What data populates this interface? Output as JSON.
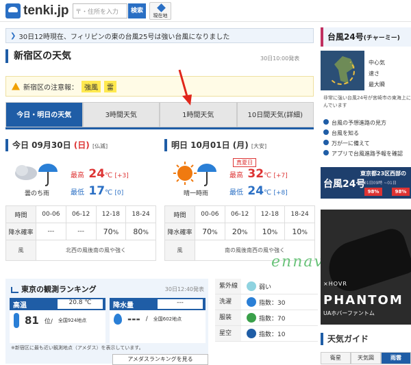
{
  "header": {
    "logo": "tenki.jp",
    "search_placeholder": "〒・住所を入力",
    "search_button": "検索",
    "location_button": "現在地"
  },
  "banner": {
    "text": "30日12時現在、フィリピンの東の台風25号は強い台風になりました"
  },
  "page_title": "新宿区の天気",
  "timestamp": "30日10:00発表",
  "warnings": {
    "label": "新宿区の注意報：",
    "items": [
      "強風",
      "雷"
    ]
  },
  "tabs": [
    "今日・明日の天気",
    "3時間天気",
    "1時間天気",
    "10日間天気(詳細)"
  ],
  "today": {
    "head": "今日 09月30日",
    "weekday": "(日)",
    "rokuyo": "[仏滅]",
    "desc": "曇のち雨",
    "high_label": "最高",
    "high": "24",
    "high_diff": "[+3]",
    "low_label": "最低",
    "low": "17",
    "low_diff": "[0]",
    "unit": "℃"
  },
  "tomorrow": {
    "head": "明日 10月01日 (月)",
    "rokuyo": "[大安]",
    "holiday": "真夏日",
    "desc": "晴一時雨",
    "high_label": "最高",
    "high": "32",
    "high_diff": "[+7]",
    "low_label": "最低",
    "low": "24",
    "low_diff": "[+8]",
    "unit": "℃"
  },
  "table_labels": {
    "time": "時間",
    "rain": "降水確率",
    "wind": "風",
    "pct": "%"
  },
  "periods": [
    "00-06",
    "06-12",
    "12-18",
    "18-24"
  ],
  "today_rain": [
    "---",
    "---",
    "70",
    "80"
  ],
  "today_wind": "北西の風後南の風や強く",
  "tomorrow_rain": [
    "70",
    "20",
    "10",
    "10"
  ],
  "tomorrow_wind": "南の風後南西の風や強く",
  "ranking": {
    "title": "東京の観測ランキング",
    "timestamp": "30日12:40発表",
    "high_label": "高温",
    "high_value": "20.8 ℃",
    "high_rank": "81",
    "high_rank_suffix": "位/",
    "high_total": "全国924地点",
    "rain_label": "降水量",
    "rain_value": "---",
    "rain_rank": "---",
    "rain_rank_suffix": "/",
    "rain_total": "全国602地点",
    "note": "※新宿区に最も近い観測地点（アメダス）を表示しています。",
    "button": "アメダスランキングを見る"
  },
  "indices": [
    {
      "label": "紫外線",
      "value": "弱い"
    },
    {
      "label": "洗濯",
      "value": "指数：30"
    },
    {
      "label": "服装",
      "value": "指数：70"
    },
    {
      "label": "星空",
      "value": "指数：10"
    }
  ],
  "watermark": "ennavi",
  "right": {
    "typhoon_title": "台風24号",
    "typhoon_sub": "(チャーミー)",
    "typhoon_fields": [
      "中心気",
      "速さ",
      "最大瞬"
    ],
    "typhoon_text": "非常に強い台風24号が宮崎市の東海上にんでいます",
    "links": [
      "台風の予想進路の見方",
      "台風を知る",
      "万が一に備えて",
      "アプリで台風進路予報を確認"
    ],
    "promo_title": "台風24号",
    "promo_head": "東京都23区西部の",
    "promo_dates": "~01日09時 ~01日",
    "promo_pct1": "98%",
    "promo_pct2": "98%",
    "ad_logo": "⨯HOVR",
    "ad_big": "PHANTOM",
    "ad_sub": "UAホバーファントム",
    "guide_title": "天気ガイド",
    "guide_tabs": [
      "衛星",
      "天気図",
      "雨雲"
    ]
  }
}
